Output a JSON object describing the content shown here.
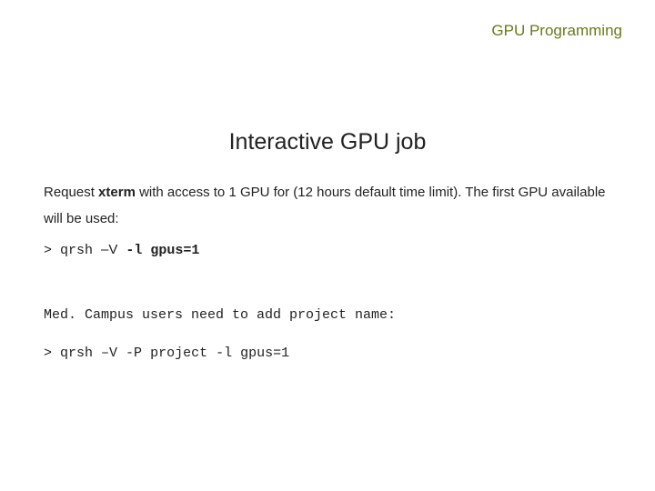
{
  "header": {
    "label": "GPU Programming"
  },
  "title": "Interactive GPU job",
  "para": {
    "pre": "Request ",
    "bold": "xterm",
    "post": " with access to 1 GPU for (12 hours default time limit).  The first GPU available will be used:"
  },
  "cmd1": {
    "prompt": "> qrsh ",
    "flag": "–V",
    "spacer": "  ",
    "arg": "-l gpus=1"
  },
  "note": "Med. Campus users need to add project name:",
  "cmd2": {
    "prompt": "> qrsh ",
    "flag": "–V",
    "spacer": "  ",
    "arg_pre": "-P ",
    "arg_italic": "project",
    "arg_post": " -l gpus=1"
  }
}
